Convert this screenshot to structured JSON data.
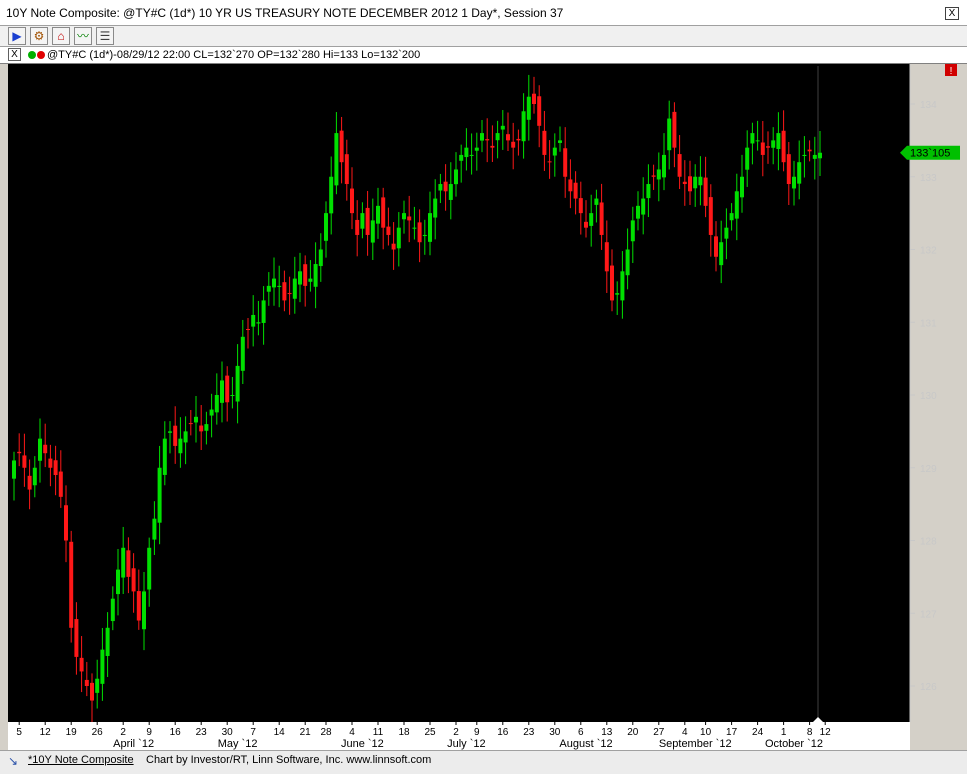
{
  "window": {
    "title": "10Y Note Composite: @TY#C (1d*) 10 YR US TREASURY NOTE DECEMBER 2012 1 Day*, Session 37",
    "close_glyph": "X"
  },
  "toolbar": {
    "buttons": [
      {
        "name": "play-icon",
        "glyph": "▶"
      },
      {
        "name": "gear-icon",
        "glyph": "⚙"
      },
      {
        "name": "home-icon",
        "glyph": "⌂"
      },
      {
        "name": "chart-icon",
        "glyph": "〰"
      },
      {
        "name": "notes-icon",
        "glyph": "☰"
      }
    ]
  },
  "infobar": {
    "close_glyph": "X",
    "text": "@TY#C (1d*)-08/29/12 22:00 CL=132`270 OP=132`280 Hi=133 Lo=132`200"
  },
  "colors": {
    "up": "#00e000",
    "down": "#ff1818",
    "background": "#000000",
    "axis": "#c8c8c8",
    "last_price_marker": "#00c000"
  },
  "chart_data": {
    "type": "candlestick",
    "title": "",
    "xlabel": "",
    "ylabel": "",
    "ylim": [
      125.5,
      134.5
    ],
    "price_ticks": [
      126,
      127,
      128,
      129,
      130,
      131,
      132,
      133,
      134
    ],
    "last_price_label": "133`105",
    "last_price": 133.33,
    "day_labels": [
      {
        "label": "5",
        "index": 1
      },
      {
        "label": "12",
        "index": 6
      },
      {
        "label": "19",
        "index": 11
      },
      {
        "label": "26",
        "index": 16
      },
      {
        "label": "2",
        "index": 21
      },
      {
        "label": "9",
        "index": 26
      },
      {
        "label": "16",
        "index": 31
      },
      {
        "label": "23",
        "index": 36
      },
      {
        "label": "30",
        "index": 41
      },
      {
        "label": "7",
        "index": 46
      },
      {
        "label": "14",
        "index": 51
      },
      {
        "label": "21",
        "index": 56
      },
      {
        "label": "28",
        "index": 60
      },
      {
        "label": "4",
        "index": 65
      },
      {
        "label": "11",
        "index": 70
      },
      {
        "label": "18",
        "index": 75
      },
      {
        "label": "25",
        "index": 80
      },
      {
        "label": "2",
        "index": 85
      },
      {
        "label": "9",
        "index": 89
      },
      {
        "label": "16",
        "index": 94
      },
      {
        "label": "23",
        "index": 99
      },
      {
        "label": "30",
        "index": 104
      },
      {
        "label": "6",
        "index": 109
      },
      {
        "label": "13",
        "index": 114
      },
      {
        "label": "20",
        "index": 119
      },
      {
        "label": "27",
        "index": 124
      },
      {
        "label": "4",
        "index": 129
      },
      {
        "label": "10",
        "index": 133
      },
      {
        "label": "17",
        "index": 138
      },
      {
        "label": "24",
        "index": 143
      },
      {
        "label": "1",
        "index": 148
      },
      {
        "label": "8",
        "index": 153
      },
      {
        "label": "12",
        "index": 156
      }
    ],
    "month_labels": [
      {
        "label": "April `12",
        "index": 23
      },
      {
        "label": "May `12",
        "index": 43
      },
      {
        "label": "June `12",
        "index": 67
      },
      {
        "label": "July `12",
        "index": 87
      },
      {
        "label": "August `12",
        "index": 110
      },
      {
        "label": "September `12",
        "index": 131
      },
      {
        "label": "October `12",
        "index": 150
      }
    ],
    "closes": [
      129.1,
      129.2,
      129.0,
      128.7,
      129.0,
      129.4,
      129.2,
      129.0,
      128.9,
      128.6,
      128.0,
      126.8,
      126.4,
      126.2,
      126.0,
      125.8,
      126.1,
      126.5,
      126.8,
      127.2,
      127.6,
      127.9,
      127.5,
      127.3,
      126.9,
      127.3,
      127.9,
      128.3,
      129.0,
      129.4,
      129.5,
      129.3,
      129.4,
      129.5,
      129.6,
      129.7,
      129.5,
      129.6,
      129.8,
      130.0,
      130.2,
      129.9,
      130.0,
      130.4,
      130.8,
      130.9,
      131.1,
      131.0,
      131.3,
      131.5,
      131.6,
      131.5,
      131.3,
      131.4,
      131.6,
      131.7,
      131.5,
      131.6,
      131.8,
      132.0,
      132.5,
      133.0,
      133.6,
      133.2,
      132.9,
      132.5,
      132.2,
      132.5,
      132.2,
      132.4,
      132.6,
      132.3,
      132.2,
      132.0,
      132.3,
      132.5,
      132.4,
      132.3,
      132.1,
      132.2,
      132.5,
      132.7,
      132.9,
      132.8,
      132.9,
      133.1,
      133.3,
      133.4,
      133.3,
      133.4,
      133.6,
      133.5,
      133.4,
      133.6,
      133.7,
      133.5,
      133.4,
      133.5,
      133.9,
      134.1,
      134.0,
      133.7,
      133.3,
      133.2,
      133.4,
      133.5,
      133.0,
      132.8,
      132.7,
      132.5,
      132.3,
      132.5,
      132.7,
      132.2,
      131.7,
      131.3,
      131.4,
      131.7,
      132.0,
      132.4,
      132.6,
      132.7,
      132.9,
      133.0,
      133.1,
      133.3,
      133.8,
      133.4,
      133.0,
      132.9,
      132.8,
      133.0,
      133.0,
      132.6,
      132.2,
      131.9,
      132.1,
      132.3,
      132.5,
      132.8,
      133.0,
      133.4,
      133.6,
      133.5,
      133.3,
      133.4,
      133.5,
      133.6,
      133.2,
      132.9,
      133.0,
      133.2,
      133.3,
      133.35,
      133.3,
      133.33
    ]
  },
  "status": {
    "link": "*10Y Note Composite",
    "credit": "Chart by Investor/RT, Linn Software, Inc. www.linnsoft.com"
  }
}
